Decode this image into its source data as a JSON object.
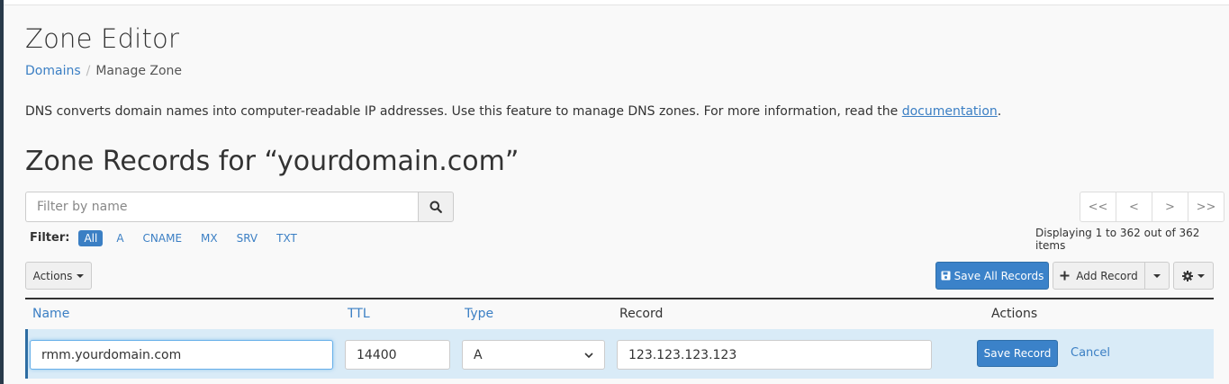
{
  "page": {
    "title": "Zone Editor",
    "breadcrumb": {
      "link": "Domains",
      "separator": "/",
      "current": "Manage Zone"
    },
    "description": {
      "text": "DNS converts domain names into computer-readable IP addresses. Use this feature to manage DNS zones. For more information, read the ",
      "link": "documentation",
      "end": "."
    },
    "section_title": "Zone Records for “yourdomain.com”"
  },
  "search": {
    "placeholder": "Filter by name",
    "icon": "search-icon"
  },
  "filter": {
    "label": "Filter:",
    "options": [
      "All",
      "A",
      "CNAME",
      "MX",
      "SRV",
      "TXT"
    ],
    "active": "All"
  },
  "pagination": {
    "first": "<<",
    "prev": "<",
    "next": ">",
    "last": ">>",
    "info": "Displaying 1 to 362 out of 362 items"
  },
  "toolbar": {
    "actions_label": "Actions",
    "save_all_label": "Save All Records",
    "add_record_label": "Add Record",
    "settings_icon": "gear-icon"
  },
  "table": {
    "headers": {
      "name": "Name",
      "ttl": "TTL",
      "type": "Type",
      "record": "Record",
      "actions": "Actions"
    }
  },
  "edit_row": {
    "name_value": "rmm.yourdomain.com",
    "ttl_value": "14400",
    "type_value": "A",
    "record_value": "123.123.123.123",
    "save_label": "Save Record",
    "cancel_label": "Cancel"
  },
  "colors": {
    "accent": "#3b7fc4",
    "primary_button": "#3b82c9",
    "edit_row_bg": "#d9ebf7",
    "sidebar": "#293a4a"
  }
}
